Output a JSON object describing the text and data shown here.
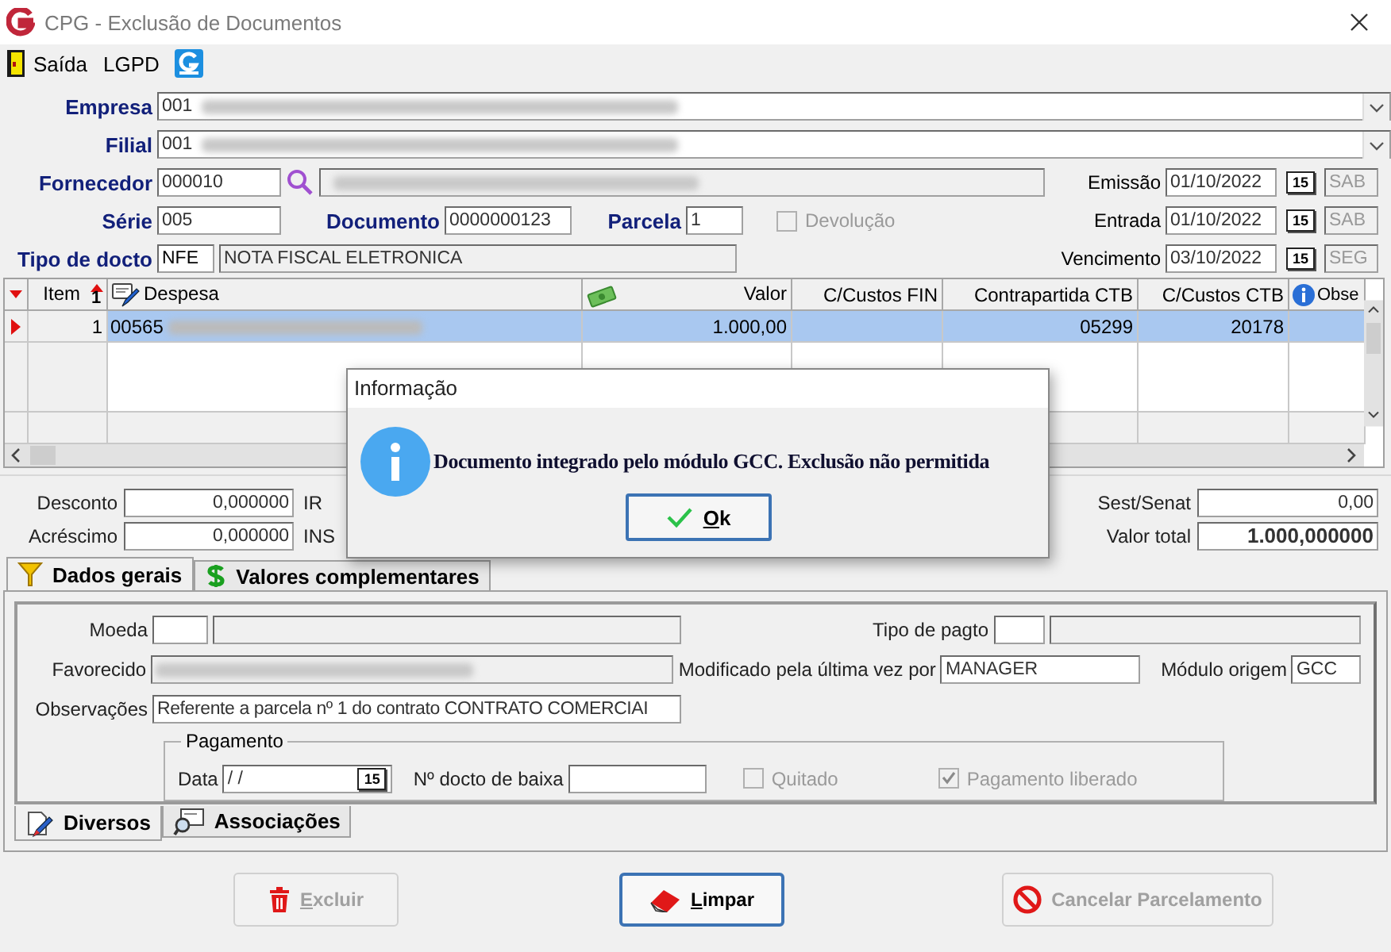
{
  "window": {
    "title": "CPG - Exclusão de Documentos"
  },
  "toolbar": {
    "exit_label": "Saída",
    "lgpd_label": "LGPD"
  },
  "header": {
    "empresa": {
      "label": "Empresa",
      "code": "001"
    },
    "filial": {
      "label": "Filial",
      "code": "001"
    },
    "fornecedor": {
      "label": "Fornecedor",
      "code": "000010"
    },
    "serie": {
      "label": "Série",
      "value": "005"
    },
    "documento": {
      "label": "Documento",
      "value": "0000000123"
    },
    "parcela": {
      "label": "Parcela",
      "value": "1"
    },
    "devolucao": {
      "label": "Devolução",
      "checked": false,
      "disabled": true
    },
    "tipo_docto": {
      "label": "Tipo de docto",
      "code": "NFE",
      "description": "NOTA FISCAL ELETRONICA"
    },
    "dates": [
      {
        "label": "Emissão",
        "value": "01/10/2022",
        "calendar_day": "15",
        "weekday": "SAB"
      },
      {
        "label": "Entrada",
        "value": "01/10/2022",
        "calendar_day": "15",
        "weekday": "SAB"
      },
      {
        "label": "Vencimento",
        "value": "03/10/2022",
        "calendar_day": "15",
        "weekday": "SEG"
      }
    ]
  },
  "grid": {
    "columns": [
      {
        "label": "Item",
        "sort_mark": "1"
      },
      {
        "label": "Despesa"
      },
      {
        "label": "Valor"
      },
      {
        "label": "C/Custos FIN"
      },
      {
        "label": "Contrapartida CTB"
      },
      {
        "label": "C/Custos CTB"
      },
      {
        "label": "Obse"
      }
    ],
    "rows": [
      {
        "selected": true,
        "item": "1",
        "despesa": "00565",
        "valor": "1.000,00",
        "contrapartida_ctb": "05299",
        "c_custos_ctb": "20178"
      }
    ]
  },
  "totals": {
    "left": [
      {
        "label": "Desconto",
        "value": "0,000000"
      },
      {
        "label": "Acréscimo",
        "value": "0,000000"
      }
    ],
    "middle_labels": [
      "IR",
      "INS"
    ],
    "right": [
      {
        "label": "Sest/Senat",
        "value": "0,00",
        "bold": false
      },
      {
        "label": "Valor total",
        "value": "1.000,000000",
        "bold": true
      }
    ]
  },
  "tabs": [
    {
      "label": "Dados gerais",
      "selected": true
    },
    {
      "label": "Valores complementares",
      "selected": false
    }
  ],
  "general": {
    "moeda": {
      "label": "Moeda"
    },
    "tipo_pagto": {
      "label": "Tipo de pagto"
    },
    "favorecido": {
      "label": "Favorecido"
    },
    "modificado": {
      "label": "Modificado pela última vez por",
      "value": "MANAGER"
    },
    "modulo_origem": {
      "label": "Módulo origem",
      "value": "GCC"
    },
    "observacoes": {
      "label": "Observações",
      "value": "Referente a parcela nº 1 do contrato CONTRATO COMERCIAI"
    },
    "pagamento": {
      "legend": "Pagamento",
      "data": {
        "label": "Data",
        "value": "/ /",
        "calendar_day": "15"
      },
      "docto_baixa": {
        "label": "Nº docto de baixa"
      },
      "quitado": {
        "label": "Quitado",
        "checked": false,
        "disabled": true
      },
      "liberado": {
        "label": "Pagamento liberado",
        "checked": true,
        "disabled": true
      }
    }
  },
  "sub_tabs": [
    {
      "label": "Diversos",
      "selected": true
    },
    {
      "label": "Associações",
      "selected": false
    }
  ],
  "buttons": [
    {
      "label": "Excluir",
      "kind": "delete",
      "disabled": true,
      "focused": false
    },
    {
      "label": "Limpar",
      "kind": "clear",
      "disabled": false,
      "focused": true
    },
    {
      "label": "Cancelar Parcelamento",
      "kind": "cancel",
      "disabled": true,
      "focused": false
    }
  ],
  "dialog": {
    "title": "Informação",
    "message": "Documento integrado pelo módulo GCC. Exclusão não permitida",
    "button": "Ok"
  }
}
